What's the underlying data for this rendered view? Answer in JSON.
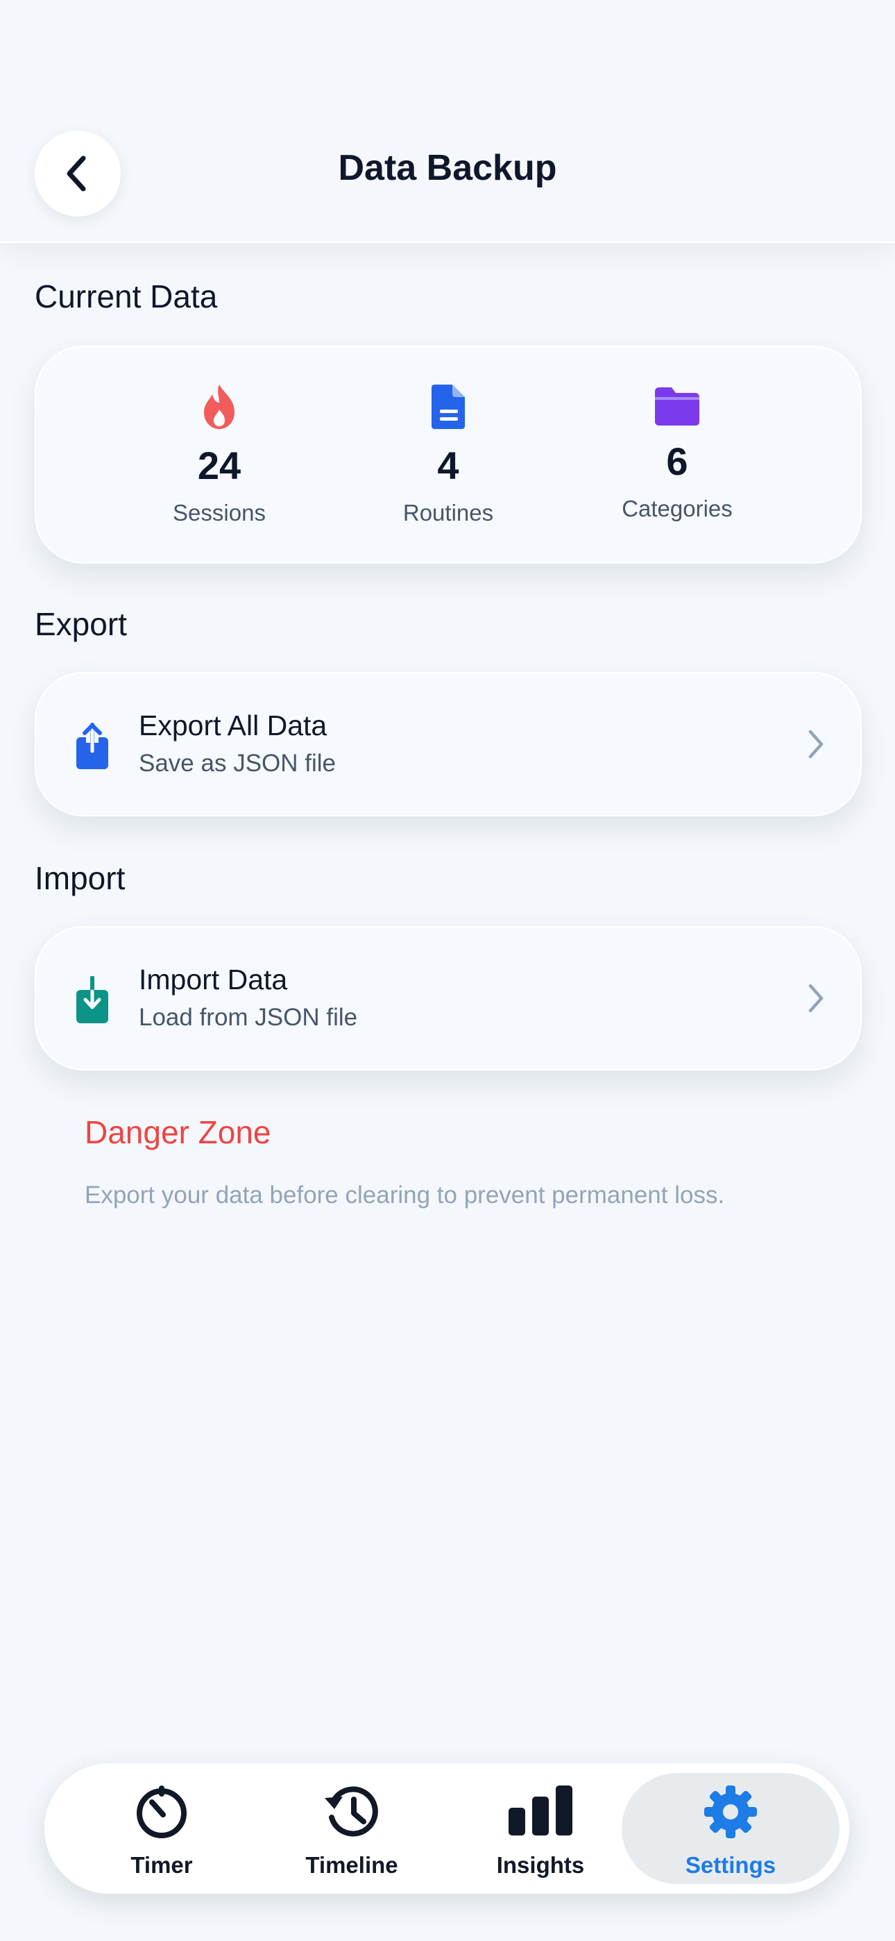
{
  "header": {
    "title": "Data Backup"
  },
  "current_data": {
    "title": "Current Data",
    "stats": [
      {
        "value": "24",
        "label": "Sessions",
        "icon": "flame-icon",
        "color": "#f25c5c"
      },
      {
        "value": "4",
        "label": "Routines",
        "icon": "document-icon",
        "color": "#2563eb"
      },
      {
        "value": "6",
        "label": "Categories",
        "icon": "folder-icon",
        "color": "#7c3aed"
      }
    ]
  },
  "export": {
    "title": "Export",
    "item_title": "Export All Data",
    "item_subtitle": "Save as JSON file",
    "icon_color": "#2563eb"
  },
  "import": {
    "title": "Import",
    "item_title": "Import Data",
    "item_subtitle": "Load from JSON file",
    "icon_color": "#0d9488"
  },
  "danger": {
    "title": "Danger Zone",
    "text": "Export your data before clearing to prevent permanent loss.",
    "color": "#ef4444"
  },
  "tabs": [
    {
      "label": "Timer",
      "icon": "stopwatch-icon"
    },
    {
      "label": "Timeline",
      "icon": "history-icon"
    },
    {
      "label": "Insights",
      "icon": "bar-chart-icon"
    },
    {
      "label": "Settings",
      "icon": "gear-icon",
      "active": true,
      "color": "#1d7ce6"
    }
  ]
}
